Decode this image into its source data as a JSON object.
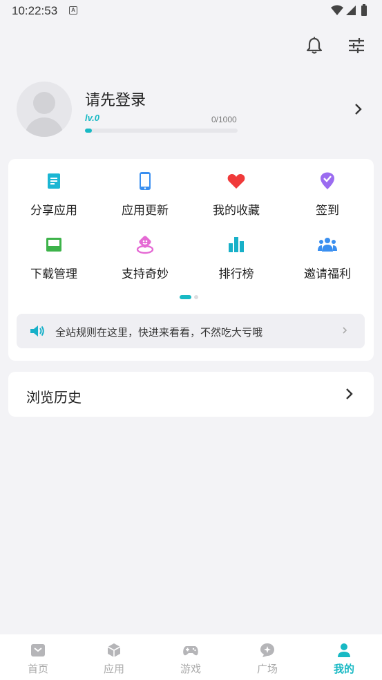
{
  "status_bar": {
    "time": "10:22:53",
    "indicator": "A",
    "icons": [
      "wifi-icon",
      "signal-icon",
      "battery-icon"
    ]
  },
  "toolbar": {
    "icons": [
      "bell-icon",
      "tune-icon"
    ]
  },
  "profile": {
    "title": "请先登录",
    "level": "lv.0",
    "exp": "0/1000",
    "progress": 0.02
  },
  "grid": {
    "items": [
      {
        "label": "分享应用",
        "icon": "share-app-icon",
        "color": "#1bb6d3"
      },
      {
        "label": "应用更新",
        "icon": "app-update-icon",
        "color": "#3a8ff0"
      },
      {
        "label": "我的收藏",
        "icon": "heart-icon",
        "color": "#f03a3a"
      },
      {
        "label": "签到",
        "icon": "checkin-icon",
        "color": "#9b6cf0"
      },
      {
        "label": "下载管理",
        "icon": "download-manage-icon",
        "color": "#3db34a"
      },
      {
        "label": "支持奇妙",
        "icon": "support-icon",
        "color": "#e56ad4"
      },
      {
        "label": "排行榜",
        "icon": "ranking-icon",
        "color": "#18b0c8"
      },
      {
        "label": "邀请福利",
        "icon": "invite-icon",
        "color": "#3a8ff0"
      }
    ],
    "page_indicator": {
      "current": 1,
      "total": 2
    }
  },
  "notice": {
    "text": "全站规则在这里，快进来看看，不然吃大亏哦"
  },
  "history": {
    "label": "浏览历史"
  },
  "bottom_nav": {
    "items": [
      {
        "label": "首页",
        "icon": "home-icon"
      },
      {
        "label": "应用",
        "icon": "app-box-icon"
      },
      {
        "label": "游戏",
        "icon": "gamepad-icon"
      },
      {
        "label": "广场",
        "icon": "plaza-icon"
      },
      {
        "label": "我的",
        "icon": "profile-icon",
        "active": true
      }
    ]
  },
  "colors": {
    "accent": "#18b9c4",
    "background": "#f3f3f6",
    "inactive_nav": "#aaaaaa"
  }
}
